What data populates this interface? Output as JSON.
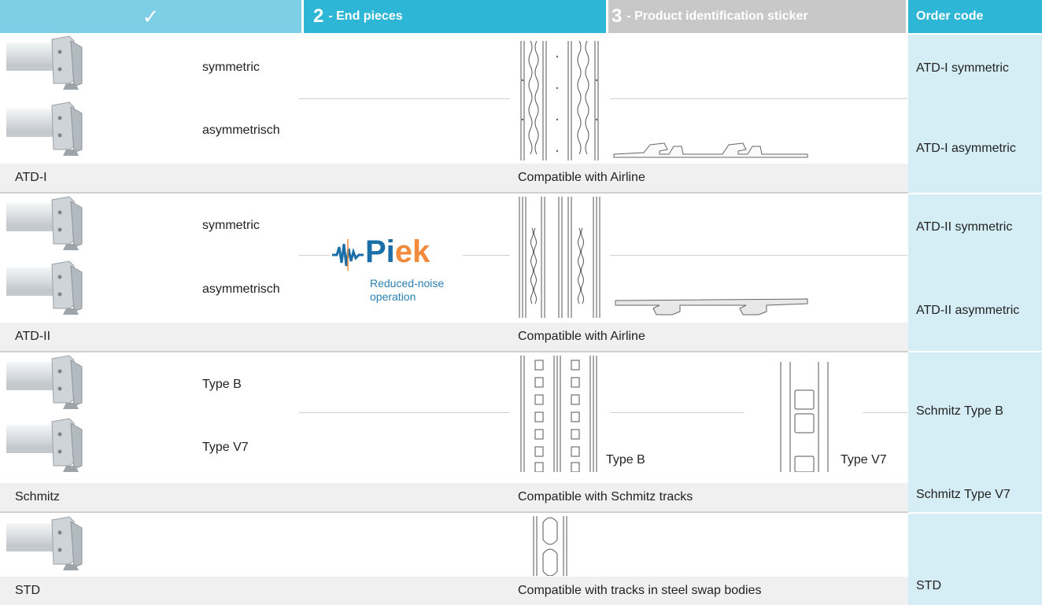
{
  "header": {
    "col1_mark": "✓",
    "col2_num": "2",
    "col2_label": "- End pieces",
    "col3_num": "3",
    "col3_label": "- Product identification sticker",
    "col4_label": "Order code"
  },
  "groups": [
    {
      "name": "ATD-I",
      "variants": [
        "symmetric",
        "asymmetrisch"
      ],
      "compat": "Compatible with Airline",
      "codes": [
        "ATD-I symmetric",
        "ATD-I asymmetric"
      ]
    },
    {
      "name": "ATD-II",
      "variants": [
        "symmetric",
        "asymmetrisch"
      ],
      "compat": "Compatible with Airline",
      "codes": [
        "ATD-II symmetric",
        "ATD-II asymmetric"
      ]
    },
    {
      "name": "Schmitz",
      "variants": [
        "Type B",
        "Type V7"
      ],
      "compat": "Compatible with Schmitz tracks",
      "codes": [
        "Schmitz Type B",
        "Schmitz Type V7"
      ],
      "drawing_labels": [
        "Type B",
        "Type V7"
      ]
    },
    {
      "name": "STD",
      "variants": [],
      "compat": "Compatible with tracks in steel swap bodies",
      "codes": [
        "STD"
      ]
    }
  ],
  "logo": {
    "brand_part1": "Pi",
    "brand_part2": "ek",
    "tagline_line1": "Reduced-noise",
    "tagline_line2": "operation"
  },
  "colors": {
    "header_light": "#7ccfe4",
    "header_dark": "#2eb6d6",
    "header_grey": "#c8c8c8",
    "order_bg": "#d5eef5",
    "bar_bg": "#f0f0f0"
  }
}
